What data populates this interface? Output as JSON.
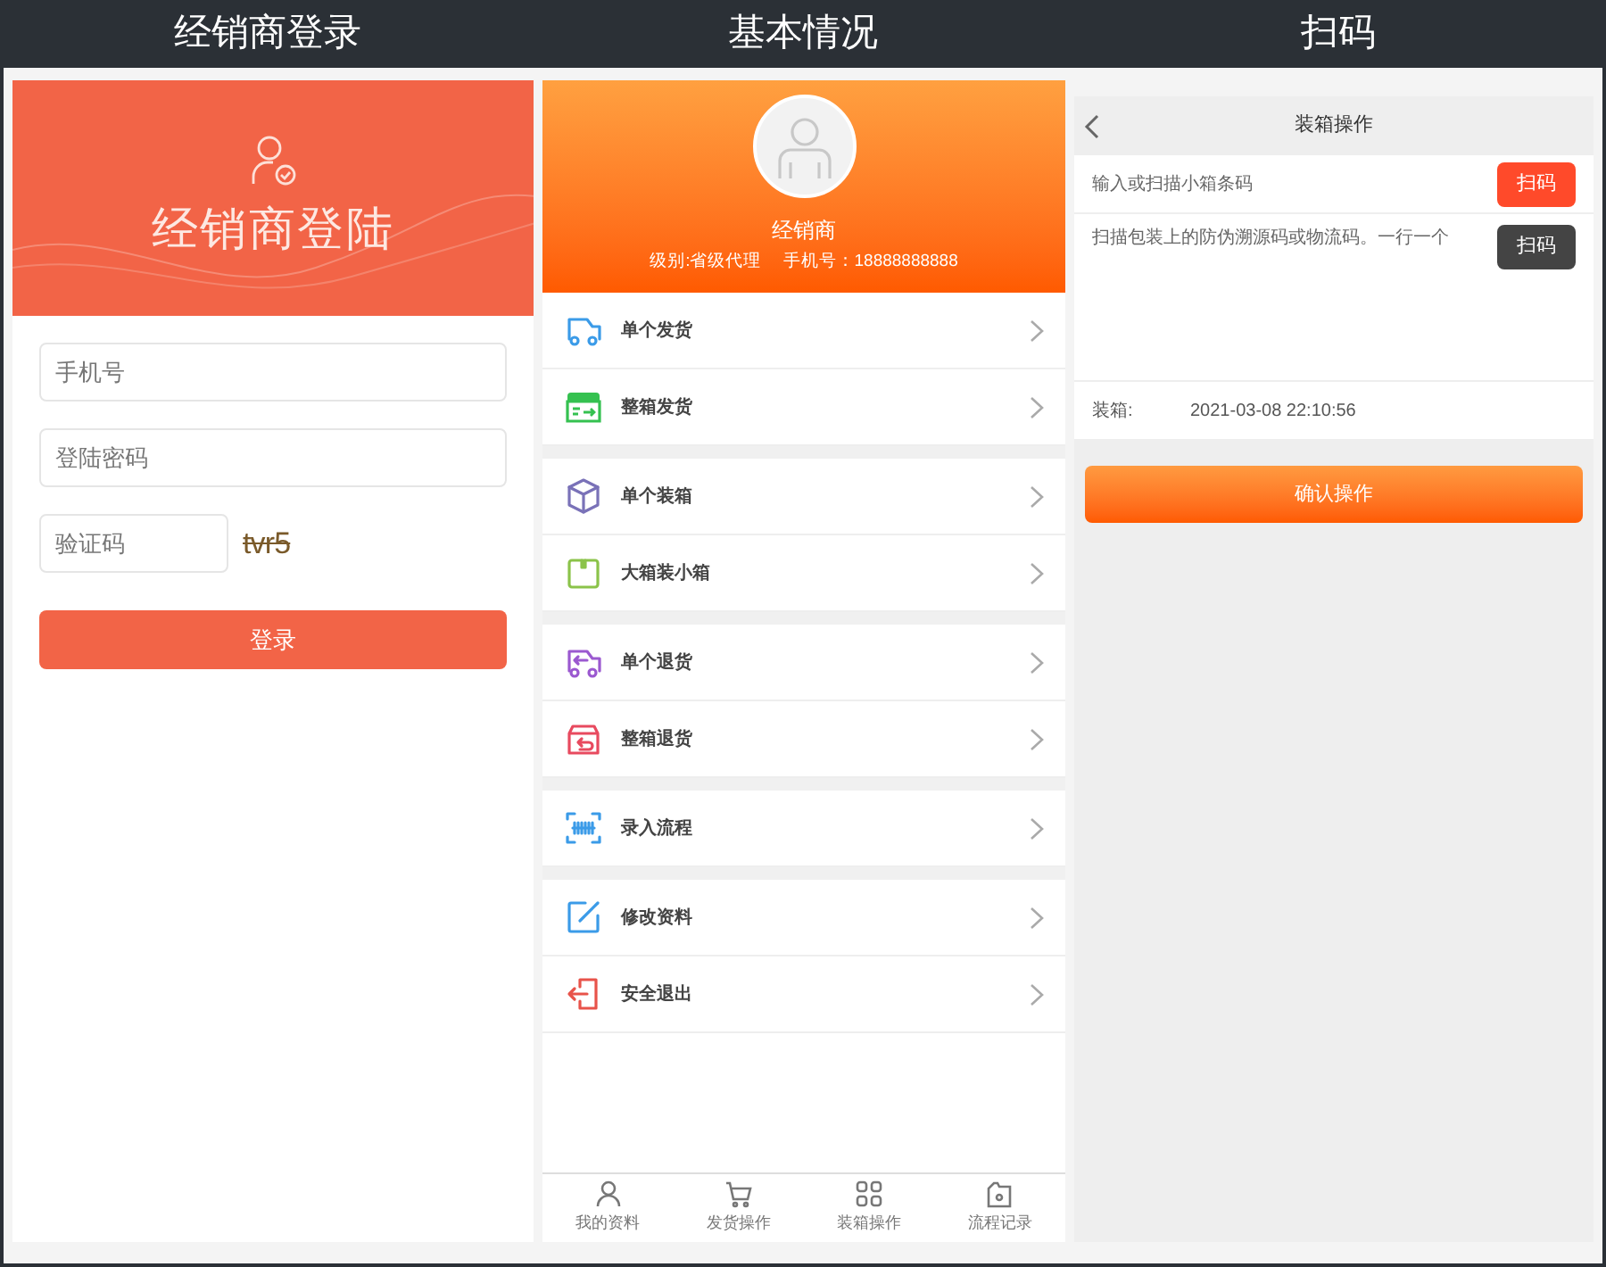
{
  "column_titles": [
    "经销商登录",
    "基本情况",
    "扫码"
  ],
  "login": {
    "banner_title": "经销商登陆",
    "phone": {
      "placeholder": "手机号"
    },
    "password": {
      "placeholder": "登陆密码"
    },
    "captcha_field": {
      "placeholder": "验证码"
    },
    "captcha_text": "tvr5",
    "submit": "登录"
  },
  "profile": {
    "name": "经销商",
    "level": "级别:省级代理",
    "phone": "手机号：18888888888",
    "menu_groups": [
      [
        {
          "label": "单个发货",
          "kind": "truck"
        },
        {
          "label": "整箱发货",
          "kind": "box-out"
        }
      ],
      [
        {
          "label": "单个装箱",
          "kind": "cube"
        },
        {
          "label": "大箱装小箱",
          "kind": "box"
        }
      ],
      [
        {
          "label": "单个退货",
          "kind": "truck-return"
        },
        {
          "label": "整箱退货",
          "kind": "box-return"
        }
      ],
      [
        {
          "label": "录入流程",
          "kind": "scan"
        }
      ],
      [
        {
          "label": "修改资料",
          "kind": "edit"
        },
        {
          "label": "安全退出",
          "kind": "exit"
        }
      ]
    ],
    "tabs": [
      {
        "label": "我的资料",
        "kind": "user"
      },
      {
        "label": "发货操作",
        "kind": "cart"
      },
      {
        "label": "装箱操作",
        "kind": "grid"
      },
      {
        "label": "流程记录",
        "kind": "record"
      }
    ]
  },
  "scan": {
    "title": "装箱操作",
    "small_box_field": {
      "placeholder": "输入或扫描小箱条码"
    },
    "scan_button_1": "扫码",
    "codes_field": {
      "placeholder": "扫描包装上的防伪溯源码或物流码。一行一个"
    },
    "scan_button_2": "扫码",
    "packing_label": "装箱:",
    "packing_time": "2021-03-08 22:10:56",
    "confirm": "确认操作"
  }
}
